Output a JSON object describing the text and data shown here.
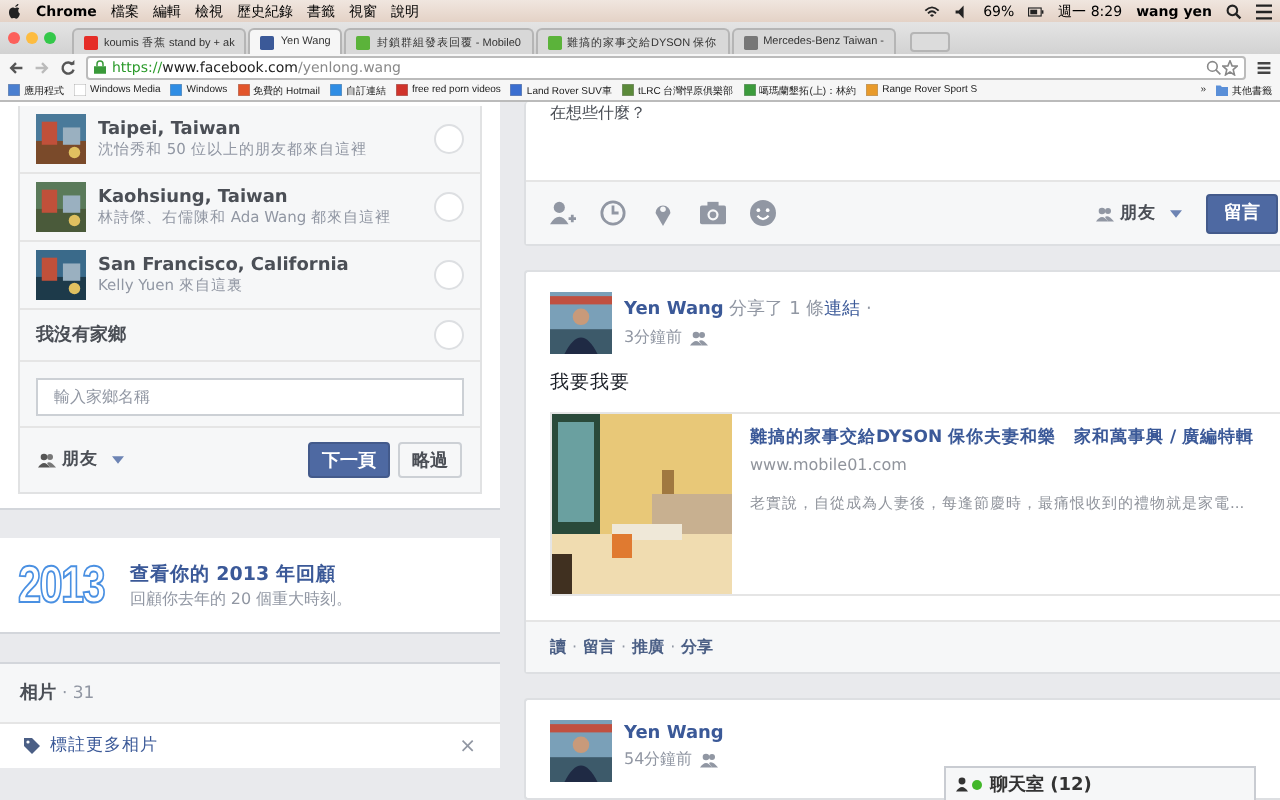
{
  "menubar": {
    "app": "Chrome",
    "menus": [
      "檔案",
      "編輯",
      "檢視",
      "歷史紀錄",
      "書籤",
      "視窗",
      "說明"
    ],
    "battery": "69%",
    "clock": "週一 8:29",
    "user": "wang yen"
  },
  "tabs": [
    {
      "title": "koumis 香蕉 stand by + ak",
      "selected": false
    },
    {
      "title": "Yen Wang",
      "selected": true
    },
    {
      "title": "封鎖群組發表回覆 - Mobile0",
      "selected": false
    },
    {
      "title": "難搞的家事交給DYSON 保你",
      "selected": false
    },
    {
      "title": "Mercedes-Benz Taiwan -",
      "selected": false
    }
  ],
  "address": {
    "scheme": "https://",
    "host": "www.facebook.com",
    "path": "/yenlong.wang"
  },
  "bookmarks": [
    "應用程式",
    "Windows Media",
    "Windows",
    "免費的 Hotmail",
    "自訂連結",
    "free red porn videos",
    "Land Rover SUV車",
    "tLRC 台灣悍原俱樂部",
    "噶瑪蘭墾拓(上)：林約",
    "Range Rover Sport S"
  ],
  "bookmarks_more": "»",
  "other_bookmarks": "其他書籤",
  "hometown": {
    "options": [
      {
        "kind": "place",
        "name": "Taipei, Taiwan",
        "friends": "沈怡秀和 50 位以上的朋友都來自這裡",
        "selected": false
      },
      {
        "kind": "place",
        "name": "Kaohsiung, Taiwan",
        "friends": "林詩傑、右儒陳和 Ada Wang 都來自這裡",
        "selected": false
      },
      {
        "kind": "place",
        "name": "San Francisco, California",
        "friends": "Kelly Yuen 來自這裏",
        "selected": false
      },
      {
        "kind": "none",
        "name": "我沒有家鄉",
        "selected": false
      }
    ],
    "input": {
      "placeholder": "輸入家鄉名稱"
    },
    "audience": "朋友",
    "next": "下一頁",
    "skip": "略過"
  },
  "year_review": {
    "year": "2013",
    "title": "查看你的 2013 年回顧",
    "subtitle": "回顧你去年的 20 個重大時刻。"
  },
  "photos": {
    "title": "相片",
    "count": "· 31",
    "tag_more": "標註更多相片",
    "close": "×"
  },
  "composer": {
    "prompt": "在想些什麼？",
    "audience": "朋友",
    "post": "留言"
  },
  "posts": [
    {
      "author": "Yen Wang",
      "action": "分享了 1 條",
      "link_word": "連結",
      "dot": "·",
      "time": "3分鐘前",
      "text": "我要我要",
      "link": {
        "title": "難搞的家事交給DYSON 保你夫妻和樂　家和萬事興 / 廣編特輯",
        "url": "www.mobile01.com",
        "desc": "老實說，自從成為人妻後，每逢節慶時，最痛恨收到的禮物就是家電..."
      },
      "actions": [
        "讀",
        "留言",
        "推廣",
        "分享"
      ],
      "separator": "·"
    },
    {
      "author": "Yen Wang",
      "time": "54分鐘前"
    }
  ],
  "chat": {
    "label": "聊天室 (12)",
    "online": true
  }
}
